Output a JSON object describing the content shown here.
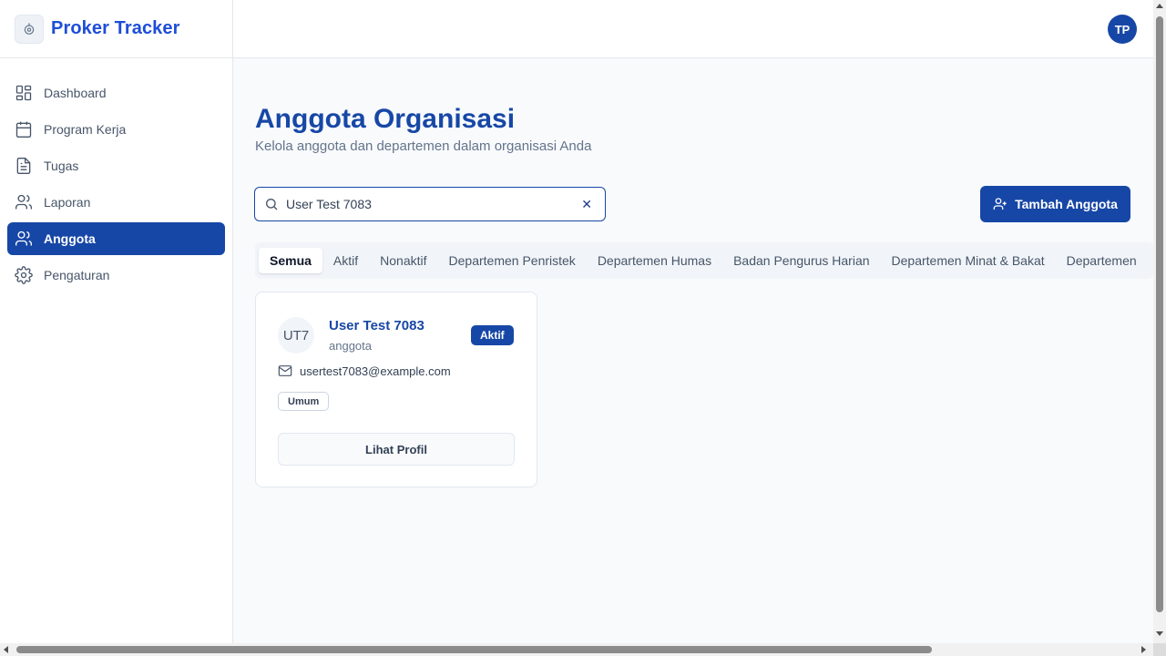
{
  "app": {
    "brand_name": "Proker Tracker",
    "user_initials": "TP"
  },
  "sidebar": {
    "items": [
      {
        "label": "Dashboard",
        "icon": "dashboard-icon",
        "active": false
      },
      {
        "label": "Program Kerja",
        "icon": "calendar-icon",
        "active": false
      },
      {
        "label": "Tugas",
        "icon": "document-icon",
        "active": false
      },
      {
        "label": "Laporan",
        "icon": "users-icon",
        "active": false
      },
      {
        "label": "Anggota",
        "icon": "users-icon",
        "active": true
      },
      {
        "label": "Pengaturan",
        "icon": "gear-icon",
        "active": false
      }
    ]
  },
  "page": {
    "title": "Anggota Organisasi",
    "subtitle": "Kelola anggota dan departemen dalam organisasi Anda"
  },
  "search": {
    "value": "User Test 7083",
    "clear_symbol": "✕"
  },
  "add_button_label": "Tambah Anggota",
  "tabs": [
    "Semua",
    "Aktif",
    "Nonaktif",
    "Departemen Penristek",
    "Departemen Humas",
    "Badan Pengurus Harian",
    "Departemen Minat & Bakat",
    "Departemen"
  ],
  "active_tab": "Semua",
  "members": [
    {
      "initials": "UT7",
      "name": "User Test 7083",
      "role": "anggota",
      "status": "Aktif",
      "email": "usertest7083@example.com",
      "department": "Umum",
      "action_label": "Lihat Profil"
    }
  ],
  "colors": {
    "primary": "#1747a6",
    "brand_text": "#1d4ed8",
    "muted_text": "#64748b",
    "border": "#e5e7eb",
    "background": "#f8fafc"
  }
}
